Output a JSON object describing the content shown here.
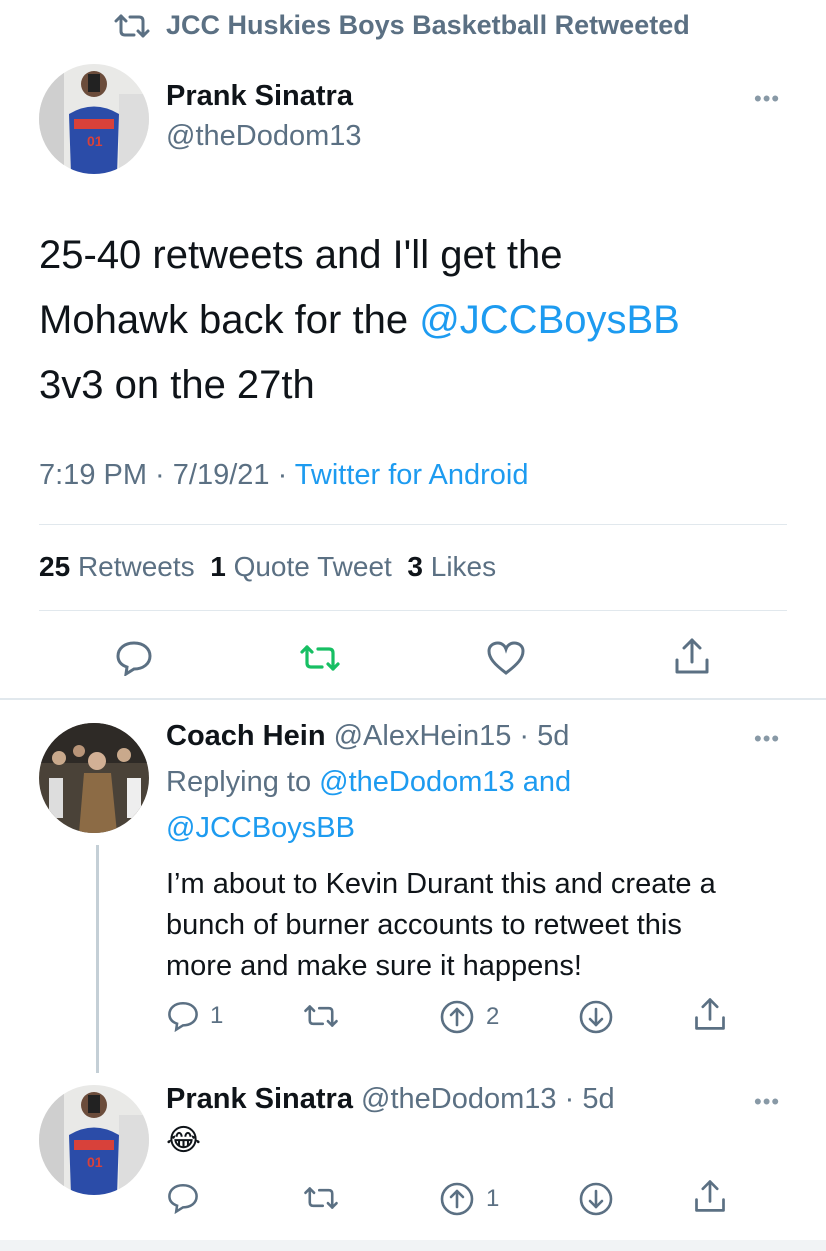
{
  "retweet_banner": {
    "text": "JCC Huskies Boys Basketball Retweeted"
  },
  "main_tweet": {
    "author_name": "Prank Sinatra",
    "author_handle": "@theDodom13",
    "text_line1": "25-40 retweets and I'll get the",
    "text_line2_prefix": "Mohawk back for the ",
    "text_line2_mention": "@JCCBoysBB",
    "text_line3": "3v3 on the 27th",
    "time": "7:19 PM · 7/19/21 · ",
    "source": "Twitter for Android",
    "retweets_count": "25",
    "retweets_label": "Retweets",
    "quotes_count": "1",
    "quotes_label": "Quote Tweet",
    "likes_count": "3",
    "likes_label": "Likes"
  },
  "reply1": {
    "author_name": "Coach Hein",
    "author_handle": "@AlexHein15",
    "time": "· 5d",
    "replying_prefix": "Replying to ",
    "replying_mention1": "@theDodom13",
    "replying_and": " and",
    "replying_mention2": "@JCCBoysBB",
    "text_line1": "I’m about to Kevin Durant this and create a",
    "text_line2": "bunch of burner accounts to retweet this",
    "text_line3": "more and make sure it happens!",
    "reply_count": "1",
    "upvote_count": "2"
  },
  "reply2": {
    "author_name": "Prank Sinatra",
    "author_handle": "@theDodom13",
    "time": "· 5d",
    "text": "😂",
    "upvote_count": "1"
  },
  "colors": {
    "accent": "#1d9bf0",
    "retweet_green": "#17bf63",
    "muted": "#5b7083"
  }
}
